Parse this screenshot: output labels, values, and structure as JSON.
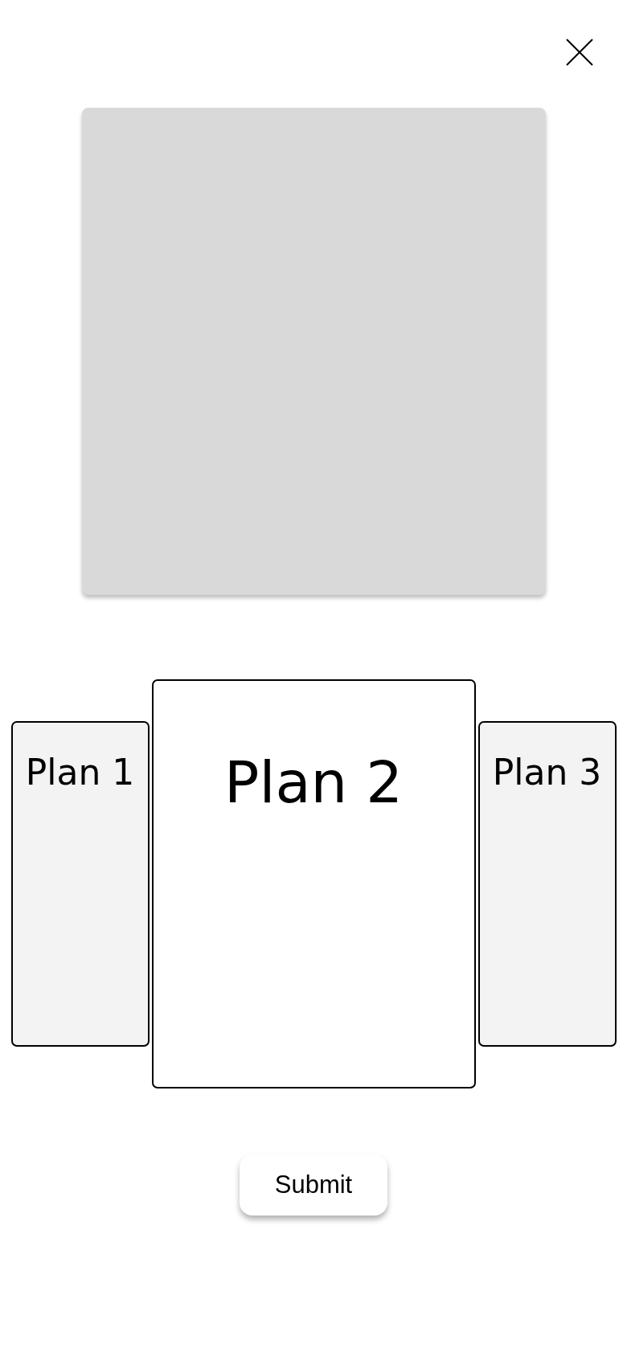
{
  "plans": [
    {
      "label": "Plan 1",
      "selected": false
    },
    {
      "label": "Plan 2",
      "selected": true
    },
    {
      "label": "Plan 3",
      "selected": false
    }
  ],
  "submit": {
    "label": "Submit"
  }
}
